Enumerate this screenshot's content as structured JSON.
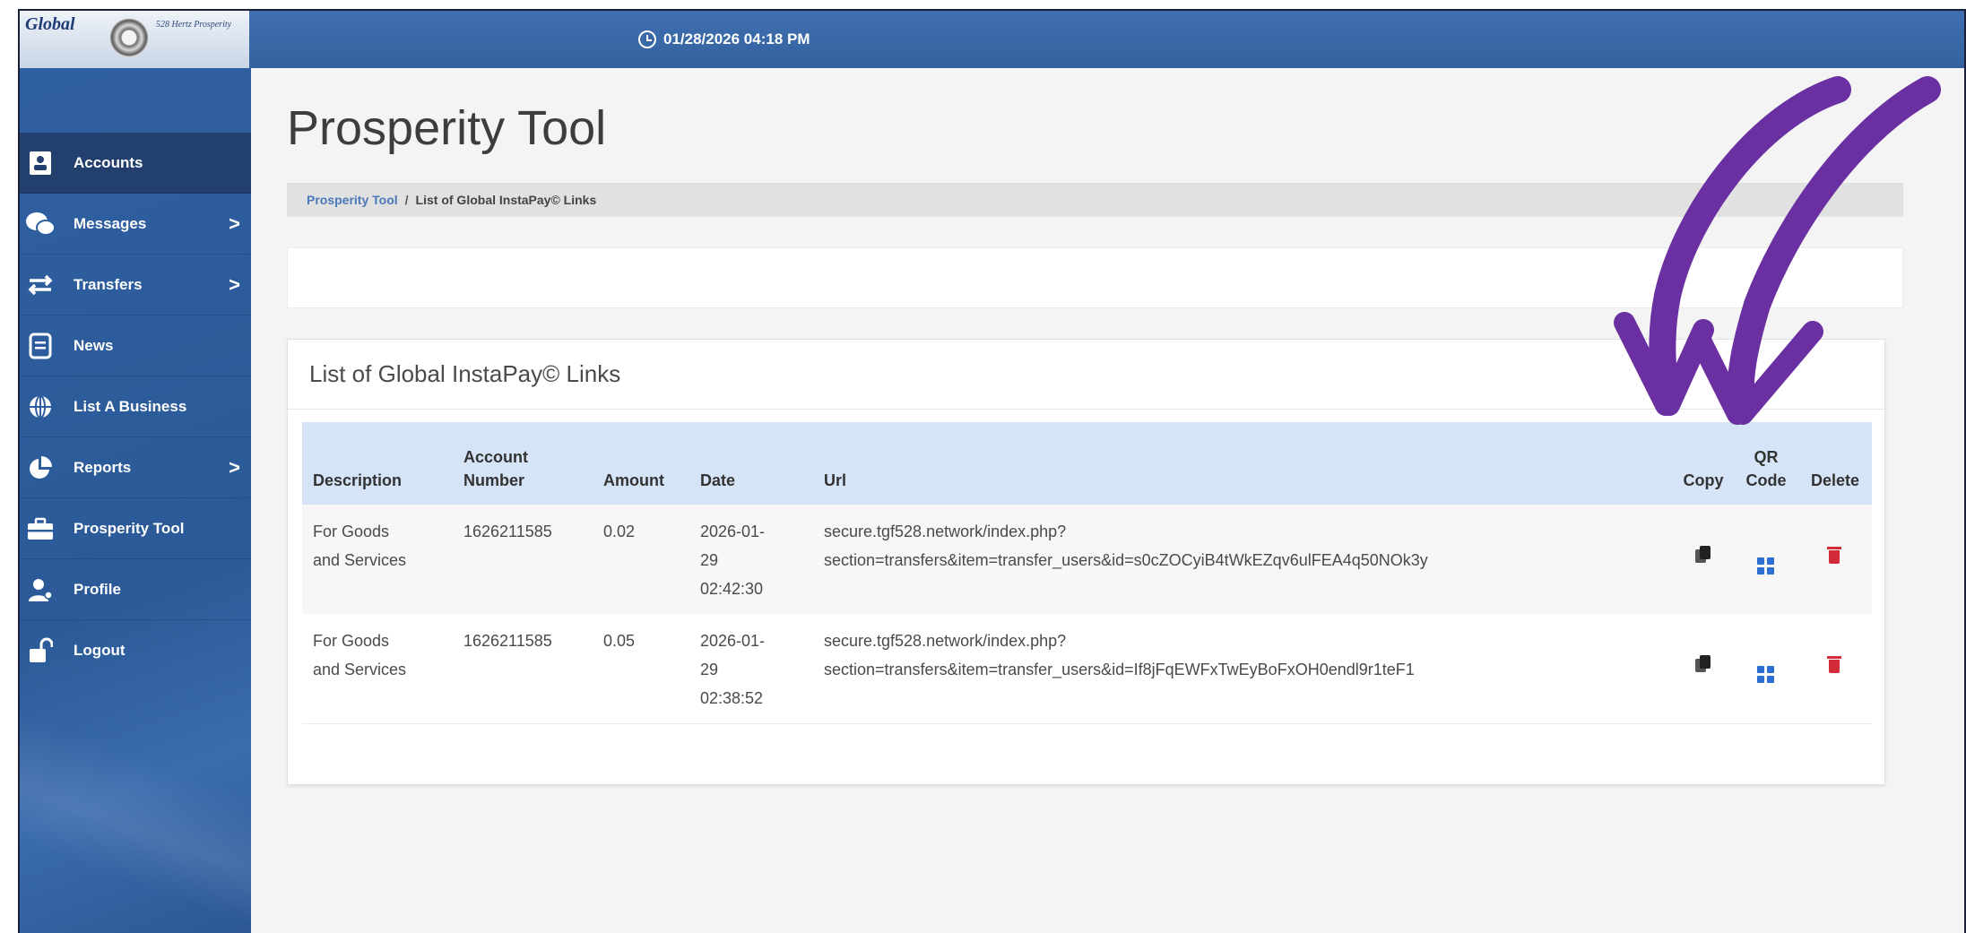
{
  "logo": {
    "brand": "Global",
    "tagline": "528 Hertz Prosperity"
  },
  "topbar": {
    "datetime": "01/28/2026 04:18 PM",
    "clock_icon": "clock-icon"
  },
  "sidebar": {
    "items": [
      {
        "label": "Accounts",
        "icon": "address-card-icon",
        "chevron": "",
        "active": true
      },
      {
        "label": "Messages",
        "icon": "chat-bubbles-icon",
        "chevron": ">",
        "active": false
      },
      {
        "label": "Transfers",
        "icon": "swap-arrows-icon",
        "chevron": ">",
        "active": false
      },
      {
        "label": "News",
        "icon": "document-icon",
        "chevron": "",
        "active": false
      },
      {
        "label": "List A Business",
        "icon": "globe-icon",
        "chevron": "",
        "active": false
      },
      {
        "label": "Reports",
        "icon": "pie-chart-icon",
        "chevron": ">",
        "active": false
      },
      {
        "label": "Prosperity Tool",
        "icon": "toolbox-icon",
        "chevron": "",
        "active": false
      },
      {
        "label": "Profile",
        "icon": "user-icon",
        "chevron": "",
        "active": false
      },
      {
        "label": "Logout",
        "icon": "unlock-icon",
        "chevron": "",
        "active": false
      }
    ]
  },
  "main": {
    "title": "Prosperity Tool",
    "breadcrumb": {
      "link": "Prosperity Tool",
      "separator": "/",
      "current": "List of Global InstaPay© Links"
    },
    "card_title": "List of Global InstaPay© Links",
    "table": {
      "headers": {
        "description": "Description",
        "account_line1": "Account",
        "account_line2": "Number",
        "amount": "Amount",
        "date": "Date",
        "url": "Url",
        "copy": "Copy",
        "qr_line1": "QR",
        "qr_line2": "Code",
        "delete": "Delete"
      },
      "rows": [
        {
          "desc_line1": "For Goods",
          "desc_line2": "and Services",
          "account": "1626211585",
          "amount": "0.02",
          "date_line1": "2026-01-",
          "date_line2": "29",
          "date_line3": "02:42:30",
          "url_line1": "secure.tgf528.network/index.php?",
          "url_line2": "section=transfers&item=transfer_users&id=s0cZOCyiB4tWkEZqv6ulFEA4q50NOk3y"
        },
        {
          "desc_line1": "For Goods",
          "desc_line2": "and Services",
          "account": "1626211585",
          "amount": "0.05",
          "date_line1": "2026-01-",
          "date_line2": "29",
          "date_line3": "02:38:52",
          "url_line1": "secure.tgf528.network/index.php?",
          "url_line2": "section=transfers&item=transfer_users&id=If8jFqEWFxTwEyBoFxOH0endl9r1teF1"
        }
      ]
    }
  },
  "colors": {
    "topbar": "#3a68a8",
    "sidebar": "#2e5fa0",
    "sidebar_active": "#223f6e",
    "table_header": "#d5e4f6",
    "annotation_arrow": "#6a2fa0",
    "delete": "#d42b3a",
    "qr": "#2d6ed1"
  }
}
